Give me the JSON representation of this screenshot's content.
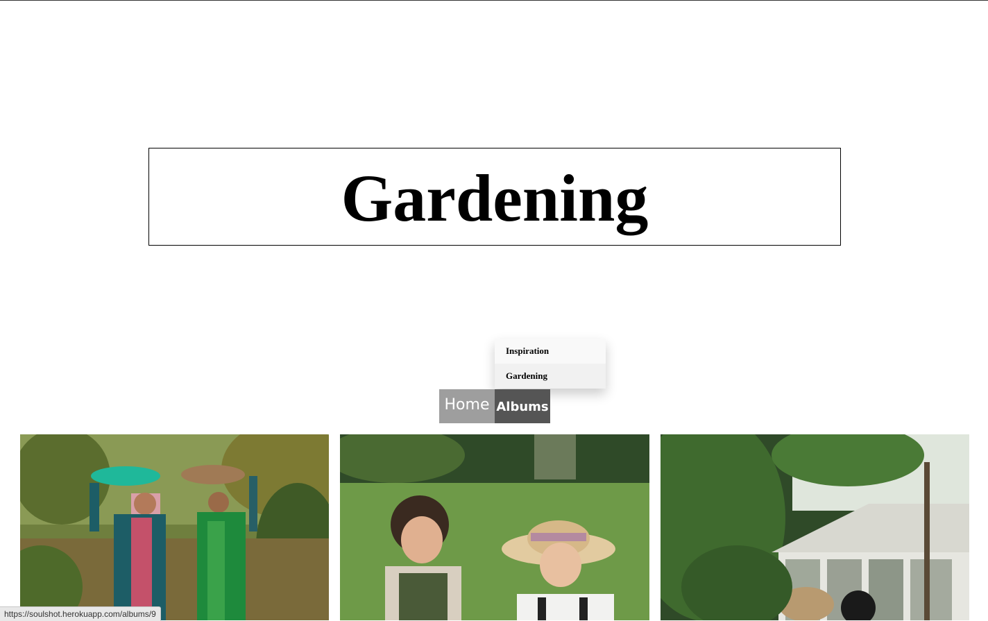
{
  "page": {
    "title": "Gardening"
  },
  "dropdown": {
    "items": [
      {
        "label": "Inspiration"
      },
      {
        "label": "Gardening"
      }
    ]
  },
  "nav": {
    "home_label": "Home",
    "albums_label": "Albums"
  },
  "photos": [
    {
      "description_icon": "photo-women-carrying-baskets"
    },
    {
      "description_icon": "photo-two-women-laughing"
    },
    {
      "description_icon": "photo-greenhouse"
    }
  ],
  "status_bar": {
    "url": "https://soulshot.herokuapp.com/albums/9"
  },
  "colors": {
    "nav_home_bg": "#9e9e9e",
    "nav_albums_bg": "#555555",
    "dropdown_bg": "#f9f9f9"
  }
}
